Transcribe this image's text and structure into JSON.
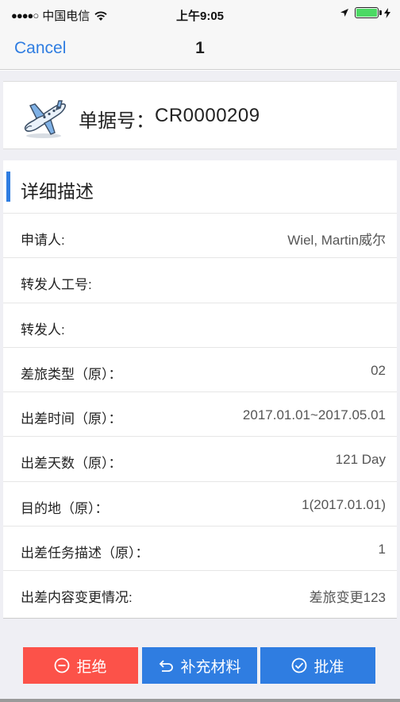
{
  "status_bar": {
    "signal": "●●●●○",
    "carrier": "中国电信",
    "time": "上午9:05",
    "battery_level": 1.0
  },
  "nav": {
    "cancel_label": "Cancel",
    "title": "1"
  },
  "doc": {
    "number_label": "单据号：",
    "number_value": "CR0000209"
  },
  "section": {
    "title": "详细描述"
  },
  "rows": [
    {
      "label": "申请人:",
      "value": "Wiel, Martin威尔"
    },
    {
      "label": "转发人工号:",
      "value": ""
    },
    {
      "label": "转发人:",
      "value": ""
    },
    {
      "label": "差旅类型（原）：",
      "value": "02"
    },
    {
      "label": "出差时间（原）：",
      "value": "2017.01.01~2017.05.01"
    },
    {
      "label": "出差天数（原）：",
      "value": "121 Day"
    },
    {
      "label": "目的地（原）：",
      "value": "1(2017.01.01)"
    },
    {
      "label": "出差任务描述（原）：",
      "value": "1"
    },
    {
      "label": "出差内容变更情况:",
      "value": "差旅变更123"
    }
  ],
  "actions": {
    "reject_label": "拒绝",
    "supplement_label": "补充材料",
    "approve_label": "批准"
  },
  "colors": {
    "accent": "#2f7de1",
    "reject": "#fc5249",
    "background": "#efeff4"
  }
}
